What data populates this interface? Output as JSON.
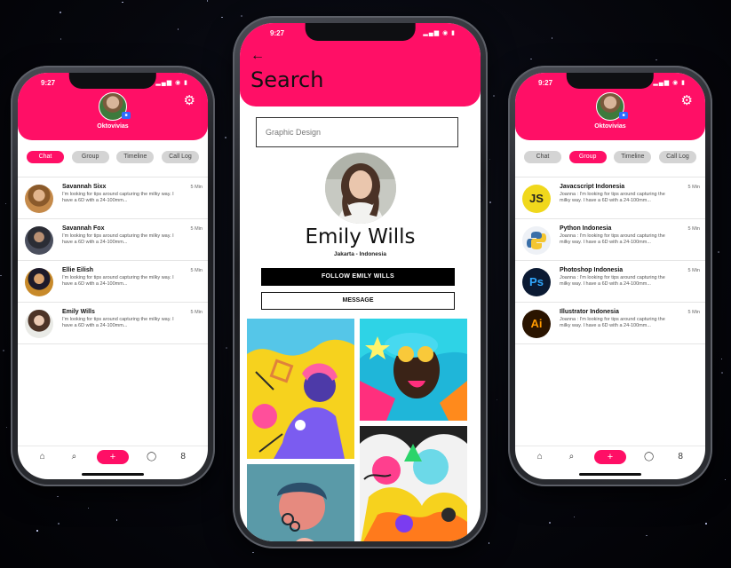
{
  "status_time": "9:27",
  "status_icons": "▂▄▆ ◉ ▮",
  "left_phone": {
    "user": "Oktovivias",
    "tabs": [
      {
        "label": "Chat",
        "active": true
      },
      {
        "label": "Group",
        "active": false
      },
      {
        "label": "Timeline",
        "active": false
      },
      {
        "label": "Call Log",
        "active": false
      }
    ],
    "rows": [
      {
        "name": "Savannah Sixx",
        "msg": "I'm looking for tips around capturing the milky way. I have a 6D with a 24-100mm...",
        "time": "5 Min"
      },
      {
        "name": "Savannah Fox",
        "msg": "I'm looking for tips around capturing the milky way. I have a 6D with a 24-100mm...",
        "time": "5 Min"
      },
      {
        "name": "Ellie Eilish",
        "msg": "I'm looking for tips around capturing the milky way. I have a 6D with a 24-100mm...",
        "time": "5 Min"
      },
      {
        "name": "Emily Wills",
        "msg": "I'm looking for tips around capturing the milky way. I have a 6D with a 24-100mm...",
        "time": "5 Min"
      }
    ]
  },
  "right_phone": {
    "user": "Oktovivias",
    "tabs": [
      {
        "label": "Chat",
        "active": false
      },
      {
        "label": "Group",
        "active": true
      },
      {
        "label": "Timeline",
        "active": false
      },
      {
        "label": "Call Log",
        "active": false
      }
    ],
    "rows": [
      {
        "name": "Javacscript Indonesia",
        "msg": "Joanna : I'm looking for tips around capturing the milky way. I have a 6D with a 24-100mm...",
        "time": "5 Min",
        "logo": "JS"
      },
      {
        "name": "Python Indonesia",
        "msg": "Joanna : I'm looking for tips around capturing the milky way. I have a 6D with a 24-100mm...",
        "time": "5 Min",
        "logo": ""
      },
      {
        "name": "Photoshop Indonesia",
        "msg": "Joanna : I'm looking for tips around capturing the milky way. I have a 6D with a 24-100mm...",
        "time": "5 Min",
        "logo": "Ps"
      },
      {
        "name": "Illustrator Indonesia",
        "msg": "Joanna : I'm looking for tips around capturing the milky way. I have a 6D with a 24-100mm...",
        "time": "5 Min",
        "logo": "Ai"
      }
    ]
  },
  "center_phone": {
    "back_icon": "←",
    "title": "Search",
    "search_value": "Graphic Design",
    "profile_name": "Emily Wills",
    "location": "Jakarta - Indonesia",
    "follow_label": "FOLLOW EMILY WILLS",
    "message_label": "MESSAGE"
  },
  "nav": {
    "home": "⌂",
    "search": "⌕",
    "add": "+",
    "chat": "◯",
    "profile": "8"
  },
  "colors": {
    "accent": "#ff0f66",
    "tab_inactive": "#d4d4d4",
    "button_dark": "#000000"
  }
}
